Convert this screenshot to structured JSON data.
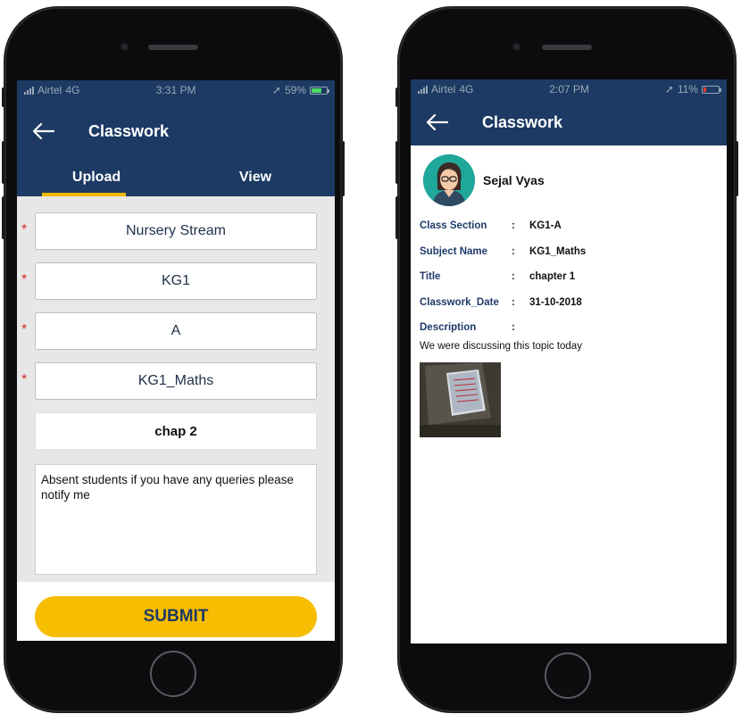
{
  "left_phone": {
    "status_bar": {
      "carrier": "Airtel",
      "network": "4G",
      "time": "3:31 PM",
      "battery": "59%"
    },
    "header": {
      "title": "Classwork"
    },
    "tabs": [
      {
        "label": "Upload"
      },
      {
        "label": "View"
      }
    ],
    "form": {
      "stream": "Nursery Stream",
      "class": "KG1",
      "section": "A",
      "subject": "KG1_Maths",
      "title": "chap 2",
      "description": "Absent students if you have any queries please notify me"
    },
    "submit_label": "SUBMIT"
  },
  "right_phone": {
    "status_bar": {
      "carrier": "Airtel",
      "network": "4G",
      "time": "2:07 PM",
      "battery": "11%"
    },
    "header": {
      "title": "Classwork"
    },
    "student": {
      "name": "Sejal  Vyas"
    },
    "details": [
      {
        "label": "Class Section",
        "value": "KG1-A"
      },
      {
        "label": "Subject Name",
        "value": "KG1_Maths"
      },
      {
        "label": "Title",
        "value": "chapter 1"
      },
      {
        "label": "Classwork_Date",
        "value": "31-10-2018"
      },
      {
        "label": "Description",
        "value": ""
      }
    ],
    "description_text": "We were discussing this topic today"
  },
  "colors": {
    "app_bar": "#1c3a63",
    "accent": "#f7bd00",
    "required_marker": "#d92b2b",
    "battery_good": "#4cd964",
    "battery_low": "#ff3b30"
  }
}
